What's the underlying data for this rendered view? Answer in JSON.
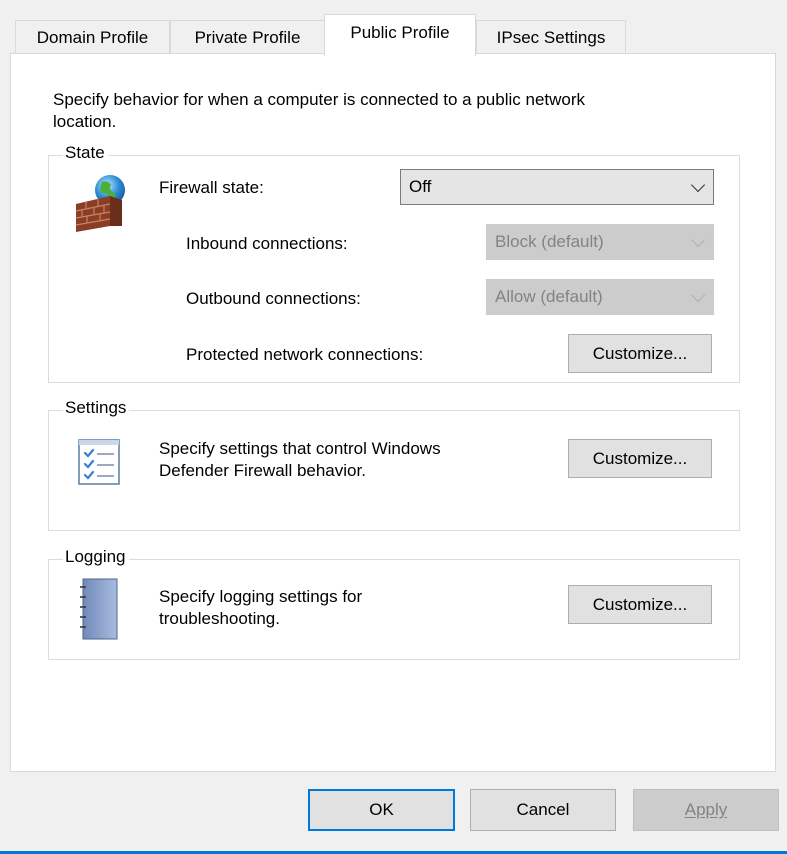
{
  "tabs": [
    {
      "label": "Domain Profile"
    },
    {
      "label": "Private Profile"
    },
    {
      "label": "Public Profile"
    },
    {
      "label": "IPsec Settings"
    }
  ],
  "description_line1": "Specify behavior for when a computer is connected to a public network",
  "description_line2": "location.",
  "state": {
    "label": "State",
    "firewall_state_label": "Firewall state:",
    "firewall_state_value": "Off",
    "inbound_label": "Inbound connections:",
    "inbound_value": "Block (default)",
    "outbound_label": "Outbound connections:",
    "outbound_value": "Allow (default)",
    "protected_label": "Protected network connections:",
    "customize_label": "Customize..."
  },
  "settings": {
    "label": "Settings",
    "text_line1": "Specify settings that control Windows",
    "text_line2": "Defender Firewall behavior.",
    "customize_label": "Customize..."
  },
  "logging": {
    "label": "Logging",
    "text_line1": "Specify logging settings for",
    "text_line2": "troubleshooting.",
    "customize_label": "Customize..."
  },
  "buttons": {
    "ok": "OK",
    "cancel": "Cancel",
    "apply": "Apply"
  },
  "colors": {
    "accent": "#0078d7",
    "window_bg": "#f0f0f0",
    "panel_bg": "#ffffff"
  },
  "icons": {
    "firewall": "firewall-brick-globe-icon",
    "settings": "checklist-icon",
    "logging": "notebook-icon"
  }
}
